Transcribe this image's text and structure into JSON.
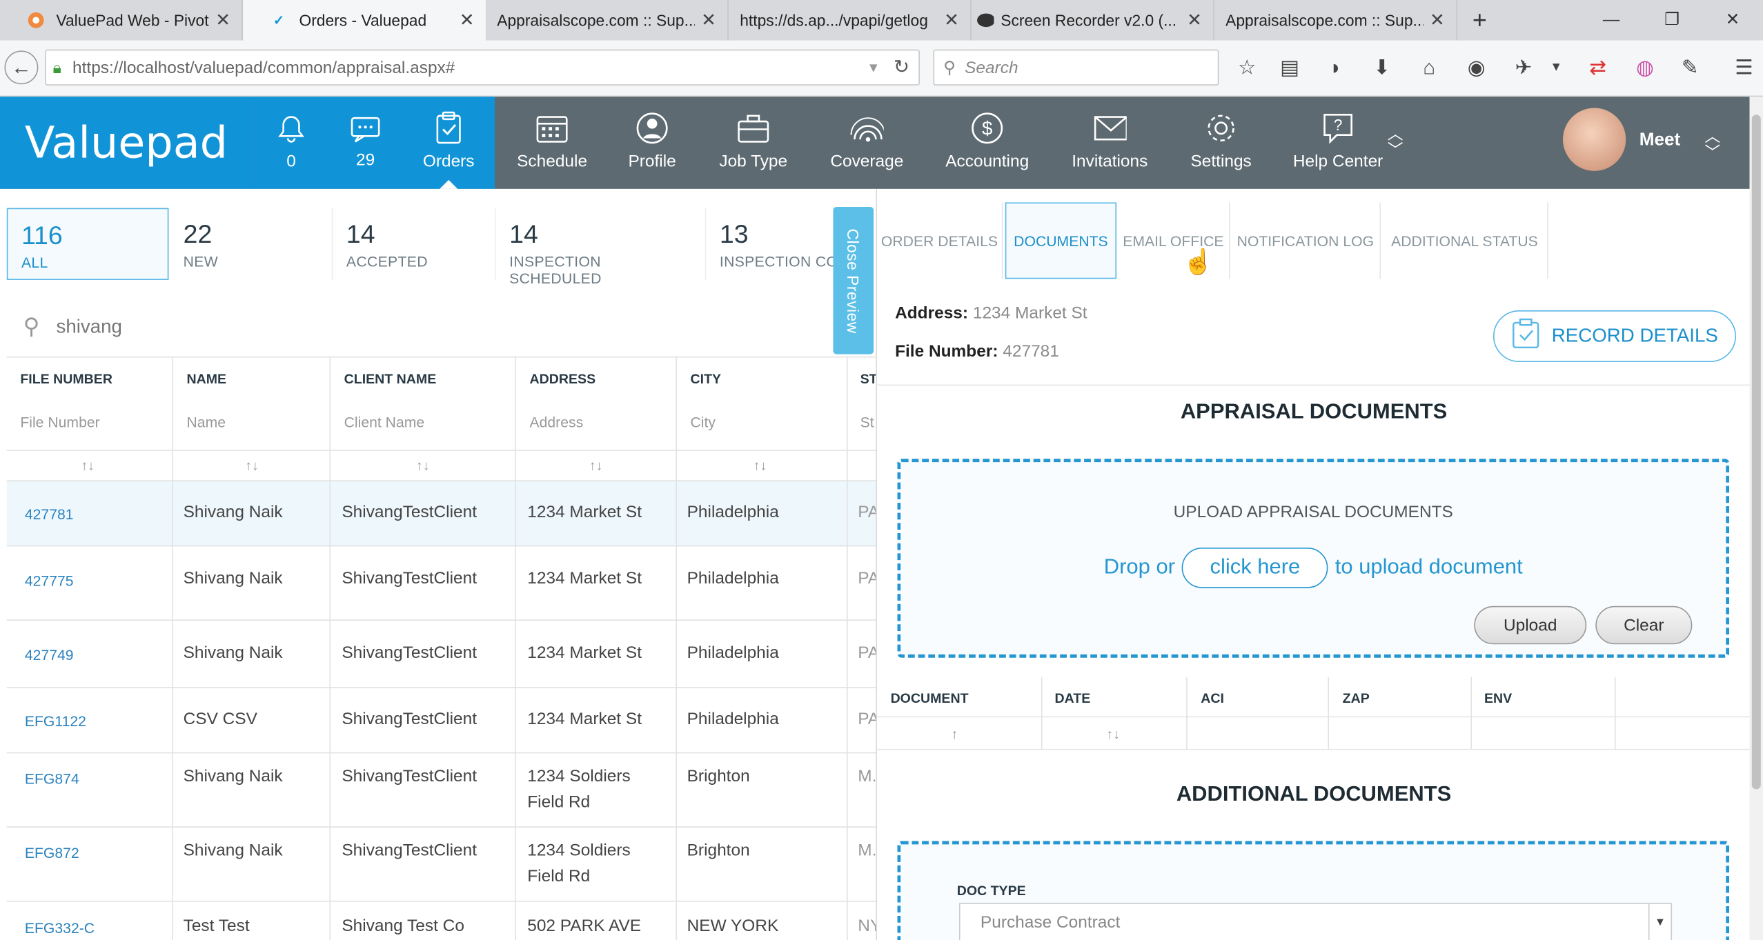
{
  "browser": {
    "tabs": [
      {
        "title": "ValuePad Web - Pivot...",
        "active": false
      },
      {
        "title": "Orders - Valuepad",
        "active": true
      },
      {
        "title": "Appraisalscope.com :: Sup...",
        "active": false
      },
      {
        "title": "https://ds.ap.../vpapi/getlog",
        "active": false
      },
      {
        "title": "Screen Recorder v2.0 (...",
        "active": false
      },
      {
        "title": "Appraisalscope.com :: Sup...",
        "active": false
      }
    ],
    "url": "https://localhost/valuepad/common/appraisal.aspx#",
    "search_placeholder": "Search"
  },
  "app": {
    "logo": "Valuepad",
    "notifications": {
      "count": "0"
    },
    "messages": {
      "count": "29"
    },
    "nav": [
      {
        "label": "Orders",
        "icon": "clipboard-icon",
        "active": true
      },
      {
        "label": "Schedule",
        "icon": "calendar-icon"
      },
      {
        "label": "Profile",
        "icon": "user-icon"
      },
      {
        "label": "Job Type",
        "icon": "briefcase-icon"
      },
      {
        "label": "Coverage",
        "icon": "coverage-icon"
      },
      {
        "label": "Accounting",
        "icon": "dollar-icon"
      },
      {
        "label": "Invitations",
        "icon": "envelope-icon"
      },
      {
        "label": "Settings",
        "icon": "gear-icon"
      },
      {
        "label": "Help Center",
        "icon": "question-icon"
      }
    ],
    "user": {
      "name": "Meet"
    },
    "accent": "#1194d7",
    "header_bg": "#5d6a71"
  },
  "orders": {
    "stats": [
      {
        "count": "116",
        "label": "ALL"
      },
      {
        "count": "22",
        "label": "NEW"
      },
      {
        "count": "14",
        "label": "ACCEPTED"
      },
      {
        "count": "14",
        "label": "INSPECTION SCHEDULED"
      },
      {
        "count": "13",
        "label": "INSPECTION CO"
      }
    ],
    "search_query": "shivang",
    "columns": [
      {
        "label": "FILE NUMBER",
        "placeholder": "File Number"
      },
      {
        "label": "NAME",
        "placeholder": "Name"
      },
      {
        "label": "CLIENT NAME",
        "placeholder": "Client Name"
      },
      {
        "label": "ADDRESS",
        "placeholder": "Address"
      },
      {
        "label": "CITY",
        "placeholder": "City"
      },
      {
        "label": "ST",
        "placeholder": "St"
      }
    ],
    "rows": [
      {
        "file": "427781",
        "name": "Shivang Naik",
        "client": "ShivangTestClient",
        "address": "1234 Market St",
        "address2": "",
        "city": "Philadelphia",
        "state": "PA"
      },
      {
        "file": "427775",
        "name": "Shivang Naik",
        "client": "ShivangTestClient",
        "address": "1234 Market St",
        "address2": "",
        "city": "Philadelphia",
        "state": "PA"
      },
      {
        "file": "427749",
        "name": "Shivang Naik",
        "client": "ShivangTestClient",
        "address": "1234 Market St",
        "address2": "",
        "city": "Philadelphia",
        "state": "PA"
      },
      {
        "file": "EFG1122",
        "name": "CSV CSV",
        "client": "ShivangTestClient",
        "address": "1234 Market St",
        "address2": "",
        "city": "Philadelphia",
        "state": "PA"
      },
      {
        "file": "EFG874",
        "name": "Shivang Naik",
        "client": "ShivangTestClient",
        "address": "1234 Soldiers",
        "address2": "Field Rd",
        "city": "Brighton",
        "state": "M."
      },
      {
        "file": "EFG872",
        "name": "Shivang Naik",
        "client": "ShivangTestClient",
        "address": "1234 Soldiers",
        "address2": "Field Rd",
        "city": "Brighton",
        "state": "M."
      },
      {
        "file": "EFG332-C",
        "name": "Test Test",
        "client": "Shivang Test Co",
        "address": "502 PARK AVE",
        "address2": "",
        "city": "NEW YORK",
        "state": "NY"
      }
    ],
    "close_preview": "Close Preview"
  },
  "preview": {
    "tabs": [
      "ORDER DETAILS",
      "DOCUMENTS",
      "EMAIL OFFICE",
      "NOTIFICATION LOG",
      "ADDITIONAL STATUS"
    ],
    "active_tab": "DOCUMENTS",
    "address_label": "Address:",
    "address": "1234 Market St",
    "file_label": "File Number:",
    "file_number": "427781",
    "record_details": "RECORD DETAILS",
    "appraisal_title": "APPRAISAL DOCUMENTS",
    "upload_title": "UPLOAD APPRAISAL DOCUMENTS",
    "drop_prefix": "Drop or",
    "click_here": "click here",
    "drop_suffix": "to upload document",
    "upload_btn": "Upload",
    "clear_btn": "Clear",
    "doc_columns": [
      "DOCUMENT",
      "DATE",
      "ACI",
      "ZAP",
      "ENV"
    ],
    "additional_title": "ADDITIONAL DOCUMENTS",
    "doc_type_label": "DOC TYPE",
    "doc_type_value": "Purchase Contract"
  }
}
